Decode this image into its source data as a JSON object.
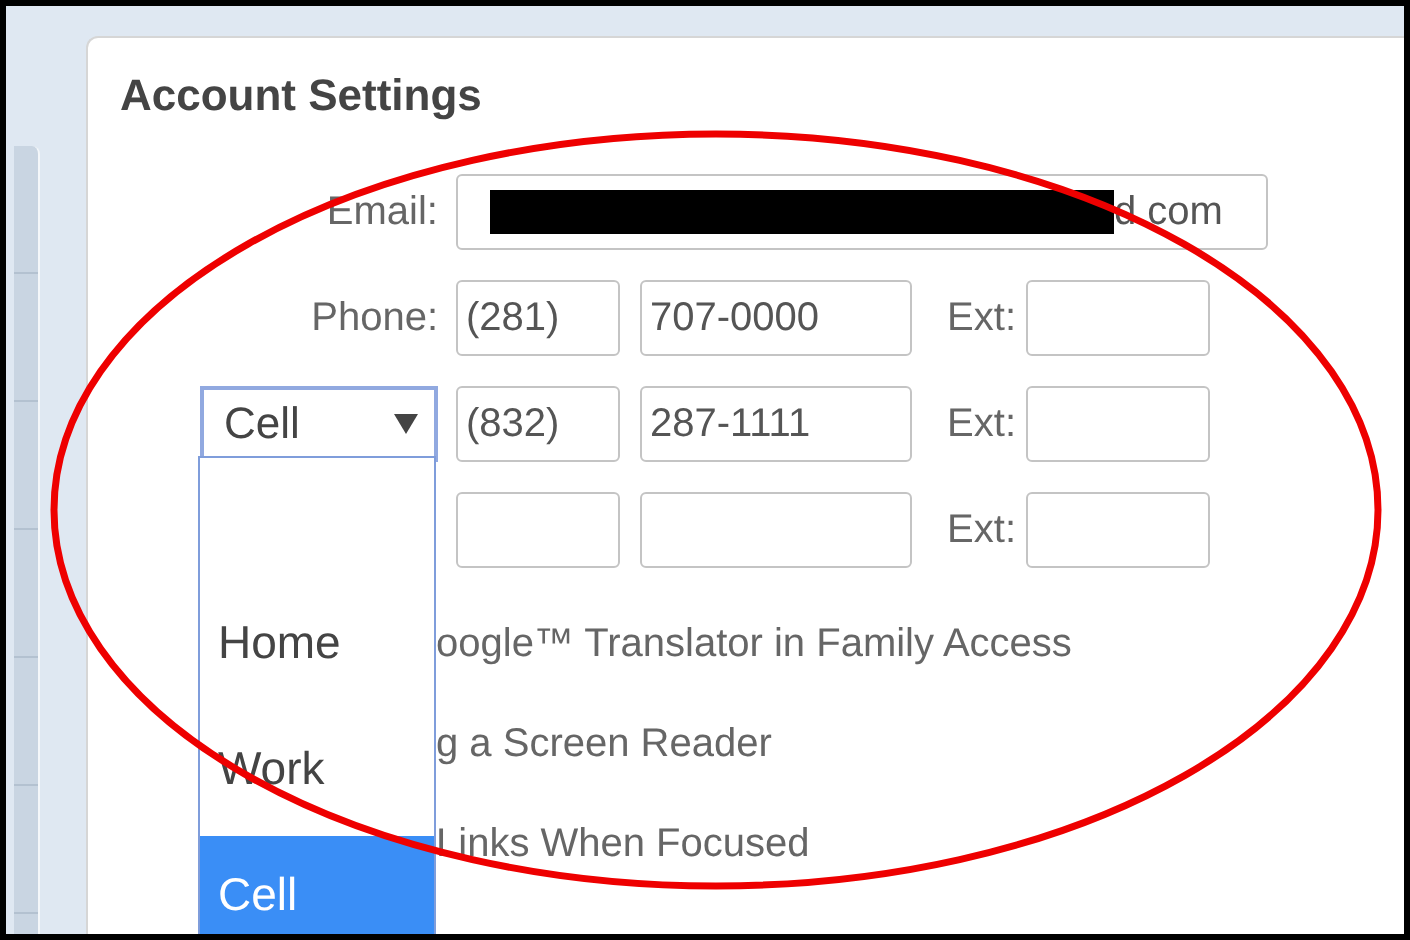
{
  "title": "Account Settings",
  "email": {
    "label": "Email:",
    "redacted": true,
    "value": "d.com"
  },
  "phones": [
    {
      "kind": "label",
      "label": "Phone:",
      "area": "(281)",
      "number": "707-0000",
      "ext_label": "Ext:"
    },
    {
      "kind": "select",
      "type": "Cell",
      "area": "(832)",
      "number": "287-1111",
      "ext_label": "Ext:"
    },
    {
      "kind": "hidden",
      "ext_label": "Ext:"
    }
  ],
  "type_dropdown": {
    "options": [
      {
        "label": "Home",
        "selected": false
      },
      {
        "label": "Work",
        "selected": false
      },
      {
        "label": "Cell",
        "selected": true
      }
    ]
  },
  "option_lines": [
    "oogle™ Translator in Family Access",
    "g a Screen Reader",
    "Links When Focused"
  ],
  "annotation": {
    "kind": "ellipse",
    "color": "#ee0000"
  }
}
